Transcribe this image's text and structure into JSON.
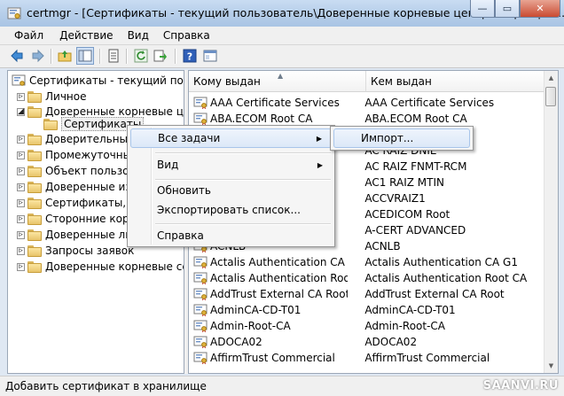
{
  "window": {
    "title": "certmgr - [Сертификаты - текущий пользователь\\Доверенные корневые центры сертифик...",
    "app_icon": "certmgr-icon"
  },
  "window_buttons": {
    "minimize": "—",
    "maximize": "▭",
    "close": "✕"
  },
  "menubar": {
    "items": [
      {
        "label": "Файл"
      },
      {
        "label": "Действие"
      },
      {
        "label": "Вид"
      },
      {
        "label": "Справка"
      }
    ]
  },
  "toolbar": {
    "buttons": [
      "back-icon",
      "forward-icon",
      "up-folder-icon",
      "show-hide-tree-icon",
      "properties-icon",
      "refresh-icon",
      "export-list-icon",
      "help-icon",
      "console-icon"
    ]
  },
  "tree": {
    "root": "Сертификаты - текущий польз",
    "items": [
      {
        "label": "Личное"
      },
      {
        "label": "Доверенные корневые цен"
      },
      {
        "label": "Сертификаты"
      },
      {
        "label": "Доверительные"
      },
      {
        "label": "Промежуточны"
      },
      {
        "label": "Объект пользов"
      },
      {
        "label": "Доверенные изд"
      },
      {
        "label": "Сертификаты, к"
      },
      {
        "label": "Сторонние корн"
      },
      {
        "label": "Доверенные ли"
      },
      {
        "label": "Запросы заявок"
      },
      {
        "label": "Доверенные корневые серт"
      }
    ]
  },
  "list": {
    "columns": [
      "Кому выдан",
      "Кем выдан"
    ],
    "rows": [
      [
        "AAA Certificate Services",
        "AAA Certificate Services"
      ],
      [
        "ABA.ECOM Root CA",
        "ABA.ECOM Root CA"
      ],
      [
        "",
        "a S.A."
      ],
      [
        "",
        "AC RAIZ DNIE"
      ],
      [
        "",
        "AC RAIZ FNMT-RCM"
      ],
      [
        "",
        "AC1 RAIZ MTIN"
      ],
      [
        "",
        "ACCVRAIZ1"
      ],
      [
        "",
        "ACEDICOM Root"
      ],
      [
        "",
        "A-CERT ADVANCED"
      ],
      [
        "ACNLB",
        "ACNLB"
      ],
      [
        "Actalis Authentication CA G1",
        "Actalis Authentication CA G1"
      ],
      [
        "Actalis Authentication Root CA",
        "Actalis Authentication Root CA"
      ],
      [
        "AddTrust External CA Root",
        "AddTrust External CA Root"
      ],
      [
        "AdminCA-CD-T01",
        "AdminCA-CD-T01"
      ],
      [
        "Admin-Root-CA",
        "Admin-Root-CA"
      ],
      [
        "ADOCA02",
        "ADOCA02"
      ],
      [
        "AffirmTrust Commercial",
        "AffirmTrust Commercial"
      ]
    ]
  },
  "context_menu": {
    "items": [
      {
        "label": "Все задачи",
        "submenu": true
      },
      {
        "label": "Вид",
        "submenu": true
      },
      {
        "label": "Обновить"
      },
      {
        "label": "Экспортировать список..."
      },
      {
        "label": "Справка"
      }
    ],
    "submenu": {
      "items": [
        {
          "label": "Импорт..."
        }
      ]
    }
  },
  "statusbar": {
    "text": "Добавить сертификат в хранилище"
  },
  "watermark": "SAANVI.RU",
  "colors": {
    "titlebar": "#b7cfea",
    "selection": "#dce8f8",
    "folder": "#e8c46a"
  }
}
